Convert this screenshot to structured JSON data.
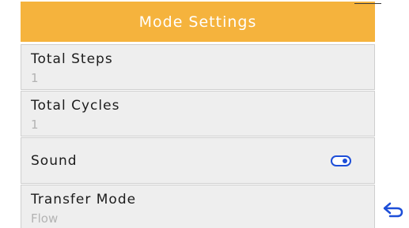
{
  "header": {
    "title": "Mode Settings"
  },
  "settings": [
    {
      "label": "Total Steps",
      "value": "1"
    },
    {
      "label": "Total Cycles",
      "value": "1"
    },
    {
      "label": "Sound",
      "toggle": "on"
    },
    {
      "label": "Transfer Mode",
      "value": "Flow"
    }
  ],
  "icons": {
    "back": "back-arrow-icon"
  },
  "colors": {
    "header_bg": "#f5b33d",
    "row_bg": "#eeeeee",
    "toggle_accent": "#1d4ed8",
    "secondary_text": "#b3b3b3"
  }
}
